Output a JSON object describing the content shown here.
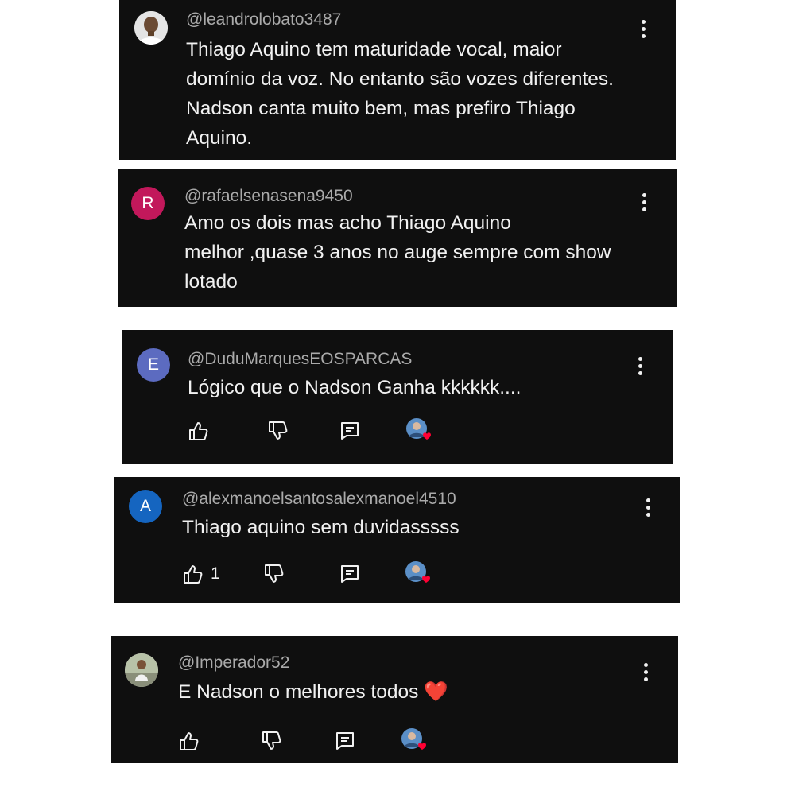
{
  "comments": [
    {
      "handle": "@leandrolobato3487",
      "text": "Thiago Aquino tem maturidade vocal, maior\ndomínio da voz. No entanto são vozes diferentes.\nNadson canta muito bem, mas prefiro Thiago\nAquino.",
      "avatar": {
        "type": "photo",
        "letter": ""
      }
    },
    {
      "handle": "@rafaelsenasena9450",
      "text": "Amo os dois mas acho Thiago Aquino\nmelhor ,quase 3 anos no auge sempre com show\nlotado",
      "avatar": {
        "type": "letter",
        "letter": "R",
        "color": "#c2185b"
      }
    },
    {
      "handle": "@DuduMarquesEOSPARCAS",
      "text": "Lógico que o Nadson Ganha kkkkkk....",
      "avatar": {
        "type": "letter",
        "letter": "E",
        "color": "#5c6bc0"
      },
      "like_count": "",
      "creator_heart": true
    },
    {
      "handle": "@alexmanoelsantosalexmanoel4510",
      "text": "Thiago aquino sem duvidasssss",
      "avatar": {
        "type": "letter",
        "letter": "A",
        "color": "#1565c0"
      },
      "like_count": "1",
      "creator_heart": true
    },
    {
      "handle": "@Imperador52",
      "text": "E Nadson o melhores todos ❤️",
      "avatar": {
        "type": "photo",
        "letter": ""
      },
      "like_count": "",
      "creator_heart": true
    }
  ],
  "colors": {
    "card_bg": "#0f0f0f",
    "handle": "#aaaaaa",
    "text": "#f1f1f1",
    "heart": "#ff0033"
  },
  "icons": [
    "like-icon",
    "dislike-icon",
    "reply-icon",
    "creator-heart-icon",
    "more-options-icon"
  ]
}
